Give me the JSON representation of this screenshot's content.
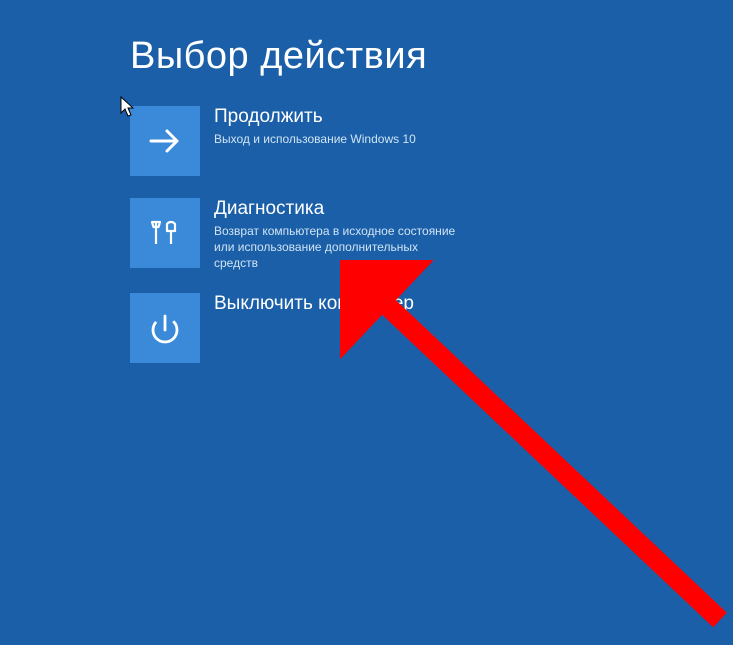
{
  "title": "Выбор действия",
  "options": [
    {
      "title": "Продолжить",
      "desc": "Выход и использование Windows 10"
    },
    {
      "title": "Диагностика",
      "desc": "Возврат компьютера в исходное состояние или использование дополнительных средств"
    },
    {
      "title": "Выключить компьютер",
      "desc": ""
    }
  ]
}
